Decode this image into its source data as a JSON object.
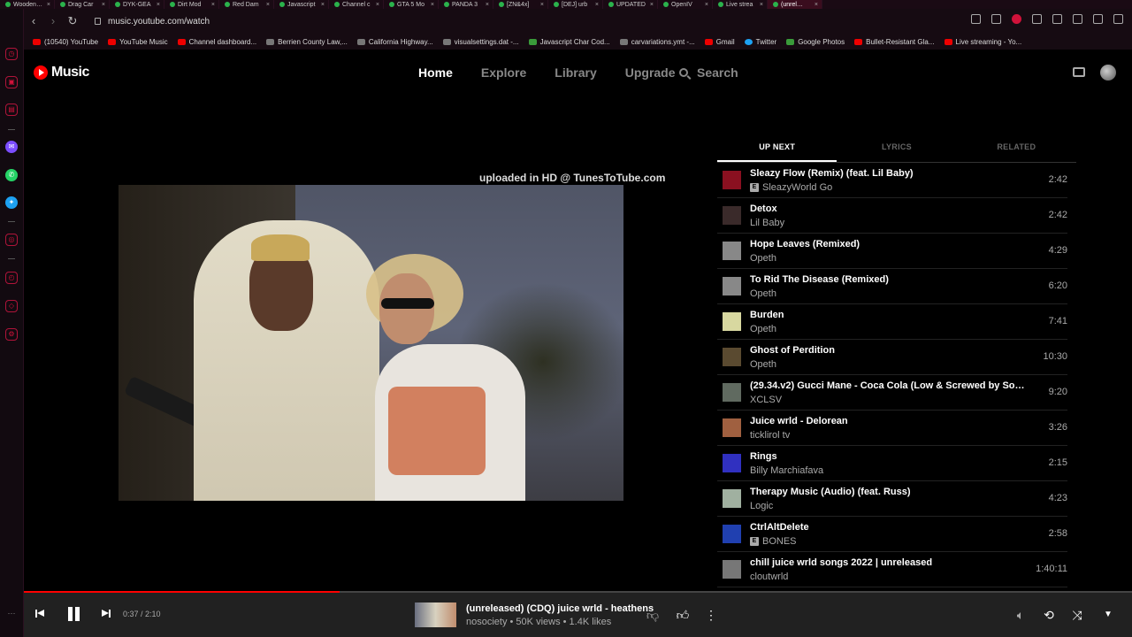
{
  "browser": {
    "tabs": [
      "Wooden…",
      "Drag Car",
      "DYK-GEA",
      "Dirt Mod",
      "Red Dam",
      "Javascript",
      "Channel c",
      "GTA 5 Mo",
      "PANDA 3",
      "[ZN&4x]",
      "[DEJ] urb",
      "UPDATED",
      "OpenIV",
      "Live strea",
      "(unrel…"
    ],
    "url": "music.youtube.com/watch",
    "bookmarks": [
      {
        "label": "(10540) YouTube",
        "icon": "youtube-icon"
      },
      {
        "label": "YouTube Music",
        "icon": "youtube-music-icon"
      },
      {
        "label": "Channel dashboard...",
        "icon": "youtube-icon"
      },
      {
        "label": "Berrien County Law,...",
        "icon": "shield-icon"
      },
      {
        "label": "California Highway...",
        "icon": "shield-icon"
      },
      {
        "label": "visualsettings.dat -...",
        "icon": "file-icon"
      },
      {
        "label": "Javascript Char Cod...",
        "icon": "cr-icon"
      },
      {
        "label": "carvariations.ymt -...",
        "icon": "github-icon"
      },
      {
        "label": "Gmail",
        "icon": "gmail-icon"
      },
      {
        "label": "Twitter",
        "icon": "twitter-icon"
      },
      {
        "label": "Google Photos",
        "icon": "google-photos-icon"
      },
      {
        "label": "Bullet-Resistant Gla...",
        "icon": "glass-icon"
      },
      {
        "label": "Live streaming - Yo...",
        "icon": "youtube-icon"
      }
    ]
  },
  "header": {
    "logo_text": "Music",
    "nav": [
      "Home",
      "Explore",
      "Library",
      "Upgrade"
    ],
    "active_nav": "Home",
    "search_label": "Search"
  },
  "video": {
    "watermark": "uploaded in HD @ TunesToTube.com"
  },
  "queue": {
    "tabs": [
      "UP NEXT",
      "LYRICS",
      "RELATED"
    ],
    "active_tab": "UP NEXT",
    "items": [
      {
        "title": "Sleazy Flow (Remix) (feat. Lil Baby)",
        "artist": "SleazyWorld Go",
        "explicit": true,
        "duration": "2:42",
        "thumb_color": "#8a1020"
      },
      {
        "title": "Detox",
        "artist": "Lil Baby",
        "explicit": false,
        "duration": "2:42",
        "thumb_color": "#3a2a2a"
      },
      {
        "title": "Hope Leaves (Remixed)",
        "artist": "Opeth",
        "explicit": false,
        "duration": "4:29",
        "thumb_color": "#888888"
      },
      {
        "title": "To Rid The Disease (Remixed)",
        "artist": "Opeth",
        "explicit": false,
        "duration": "6:20",
        "thumb_color": "#888888"
      },
      {
        "title": "Burden",
        "artist": "Opeth",
        "explicit": false,
        "duration": "7:41",
        "thumb_color": "#d8d8a0"
      },
      {
        "title": "Ghost of Perdition",
        "artist": "Opeth",
        "explicit": false,
        "duration": "10:30",
        "thumb_color": "#5a4a30"
      },
      {
        "title": "(29.34.v2) Gucci Mane - Coca Cola (Low & Screwed by Somnolen...",
        "artist": "XCLSV",
        "explicit": false,
        "duration": "9:20",
        "thumb_color": "#606a60"
      },
      {
        "title": "Juice wrld - Delorean",
        "artist": "ticklirol tv",
        "explicit": false,
        "duration": "3:26",
        "thumb_color": "#a06040"
      },
      {
        "title": "Rings",
        "artist": "Billy Marchiafava",
        "explicit": false,
        "duration": "2:15",
        "thumb_color": "#3030c0"
      },
      {
        "title": "Therapy Music (Audio) (feat. Russ)",
        "artist": "Logic",
        "explicit": false,
        "duration": "4:23",
        "thumb_color": "#a0b0a0"
      },
      {
        "title": "CtrlAltDelete",
        "artist": "BONES",
        "explicit": true,
        "duration": "2:58",
        "thumb_color": "#2040b0"
      },
      {
        "title": "chill juice wrld songs 2022 | unreleased",
        "artist": "cloutwrld",
        "explicit": false,
        "duration": "1:40:11",
        "thumb_color": "#777777"
      }
    ]
  },
  "player": {
    "time": "0:37 / 2:10",
    "progress_fraction": 0.2846,
    "title": "(unreleased) (CDQ) juice wrld - heathens",
    "meta": "nosociety • 50K views • 1.4K likes"
  },
  "colors": {
    "accent": "#ff0000",
    "browser_accent": "#d0123a"
  }
}
